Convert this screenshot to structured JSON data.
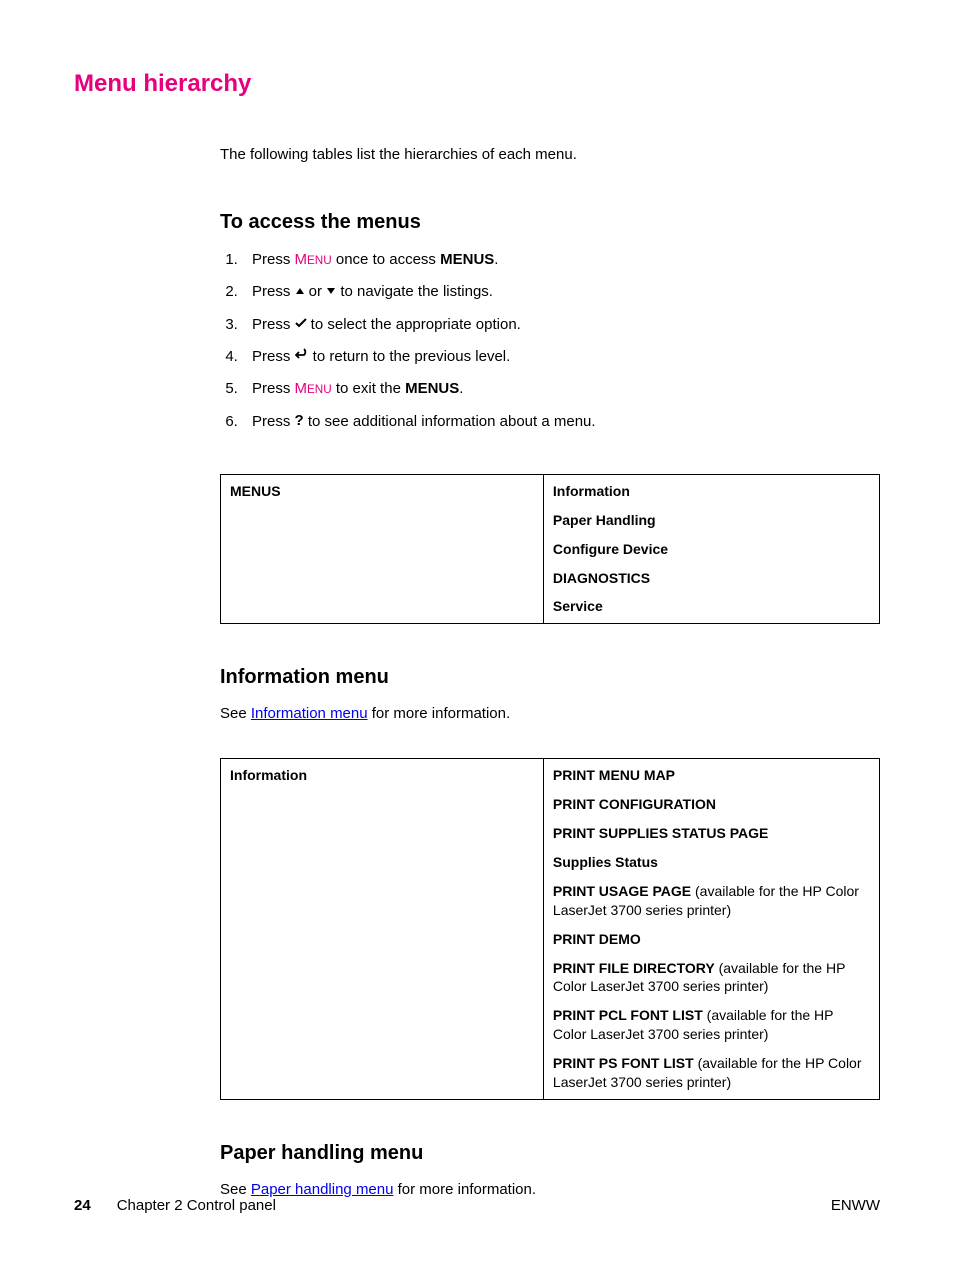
{
  "page_title": "Menu hierarchy",
  "intro": "The following tables list the hierarchies of each menu.",
  "section_access": {
    "heading": "To access the menus",
    "steps": [
      {
        "pre": "Press ",
        "menu": "Menu",
        "post": " once to access ",
        "bold": "MENUS",
        "end": "."
      },
      {
        "pre": "Press ",
        "icon": "up",
        "mid": " or ",
        "icon2": "down",
        "post": " to navigate the listings."
      },
      {
        "pre": "Press ",
        "icon": "check",
        "post": " to select the appropriate option."
      },
      {
        "pre": "Press ",
        "icon": "back",
        "post": " to return to the previous level."
      },
      {
        "pre": "Press ",
        "menu": "Menu",
        "post": " to exit the ",
        "bold": "MENUS",
        "end": "."
      },
      {
        "pre": "Press ",
        "icon": "question",
        "post": " to see additional information about a menu."
      }
    ]
  },
  "menus_table": {
    "left": "MENUS",
    "items": [
      {
        "bold": "Information"
      },
      {
        "bold": "Paper Handling"
      },
      {
        "bold": "Configure Device"
      },
      {
        "bold": "DIAGNOSTICS"
      },
      {
        "bold": "Service"
      }
    ]
  },
  "section_info": {
    "heading": "Information menu",
    "see_pre": "See ",
    "see_link": "Information menu",
    "see_post": " for more information.",
    "table_left": "Information",
    "items": [
      {
        "bold": "PRINT MENU MAP"
      },
      {
        "bold": "PRINT CONFIGURATION"
      },
      {
        "bold": "PRINT SUPPLIES STATUS PAGE"
      },
      {
        "bold": "Supplies Status"
      },
      {
        "bold": "PRINT USAGE PAGE",
        "note": " (available for the HP Color LaserJet 3700 series printer)"
      },
      {
        "bold": "PRINT DEMO"
      },
      {
        "bold": "PRINT FILE DIRECTORY",
        "note": " (available for the HP Color LaserJet 3700 series printer)"
      },
      {
        "bold": "PRINT PCL FONT LIST",
        "note": " (available for the HP Color LaserJet 3700 series printer)"
      },
      {
        "bold": "PRINT PS FONT LIST",
        "note": " (available for the HP Color LaserJet 3700 series printer)"
      }
    ]
  },
  "section_paper": {
    "heading": "Paper handling menu",
    "see_pre": "See ",
    "see_link": "Paper handling menu",
    "see_post": " for more information."
  },
  "footer": {
    "page_num": "24",
    "chapter": "Chapter 2  Control panel",
    "right": "ENWW"
  }
}
